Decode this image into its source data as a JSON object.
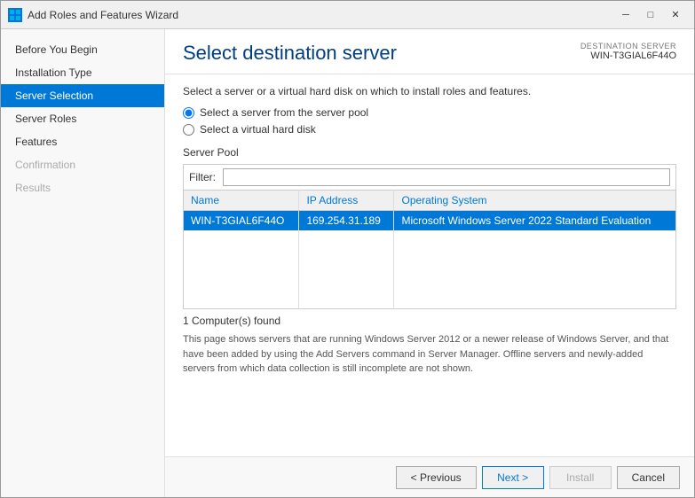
{
  "window": {
    "title": "Add Roles and Features Wizard",
    "icon_label": "W"
  },
  "title_bar": {
    "minimize_label": "─",
    "maximize_label": "□",
    "close_label": "✕"
  },
  "destination": {
    "label": "DESTINATION SERVER",
    "server_name": "WIN-T3GIAL6F44O"
  },
  "main_title": "Select destination server",
  "instruction": "Select a server or a virtual hard disk on which to install roles and features.",
  "radio_options": {
    "server_pool": "Select a server from the server pool",
    "vhd": "Select a virtual hard disk"
  },
  "server_pool_label": "Server Pool",
  "filter_label": "Filter:",
  "filter_placeholder": "",
  "table_columns": {
    "name": "Name",
    "ip_address": "IP Address",
    "operating_system": "Operating System"
  },
  "table_rows": [
    {
      "name": "WIN-T3GIAL6F44O",
      "ip_address": "169.254.31.189",
      "operating_system": "Microsoft Windows Server 2022 Standard Evaluation",
      "selected": true
    }
  ],
  "computers_found": "1 Computer(s) found",
  "info_text": "This page shows servers that are running Windows Server 2012 or a newer release of Windows Server, and that have been added by using the Add Servers command in Server Manager. Offline servers and newly-added servers from which data collection is still incomplete are not shown.",
  "sidebar": {
    "items": [
      {
        "label": "Before You Begin",
        "state": "normal"
      },
      {
        "label": "Installation Type",
        "state": "normal"
      },
      {
        "label": "Server Selection",
        "state": "active"
      },
      {
        "label": "Server Roles",
        "state": "normal"
      },
      {
        "label": "Features",
        "state": "normal"
      },
      {
        "label": "Confirmation",
        "state": "disabled"
      },
      {
        "label": "Results",
        "state": "disabled"
      }
    ]
  },
  "footer": {
    "previous_label": "< Previous",
    "next_label": "Next >",
    "install_label": "Install",
    "cancel_label": "Cancel"
  }
}
